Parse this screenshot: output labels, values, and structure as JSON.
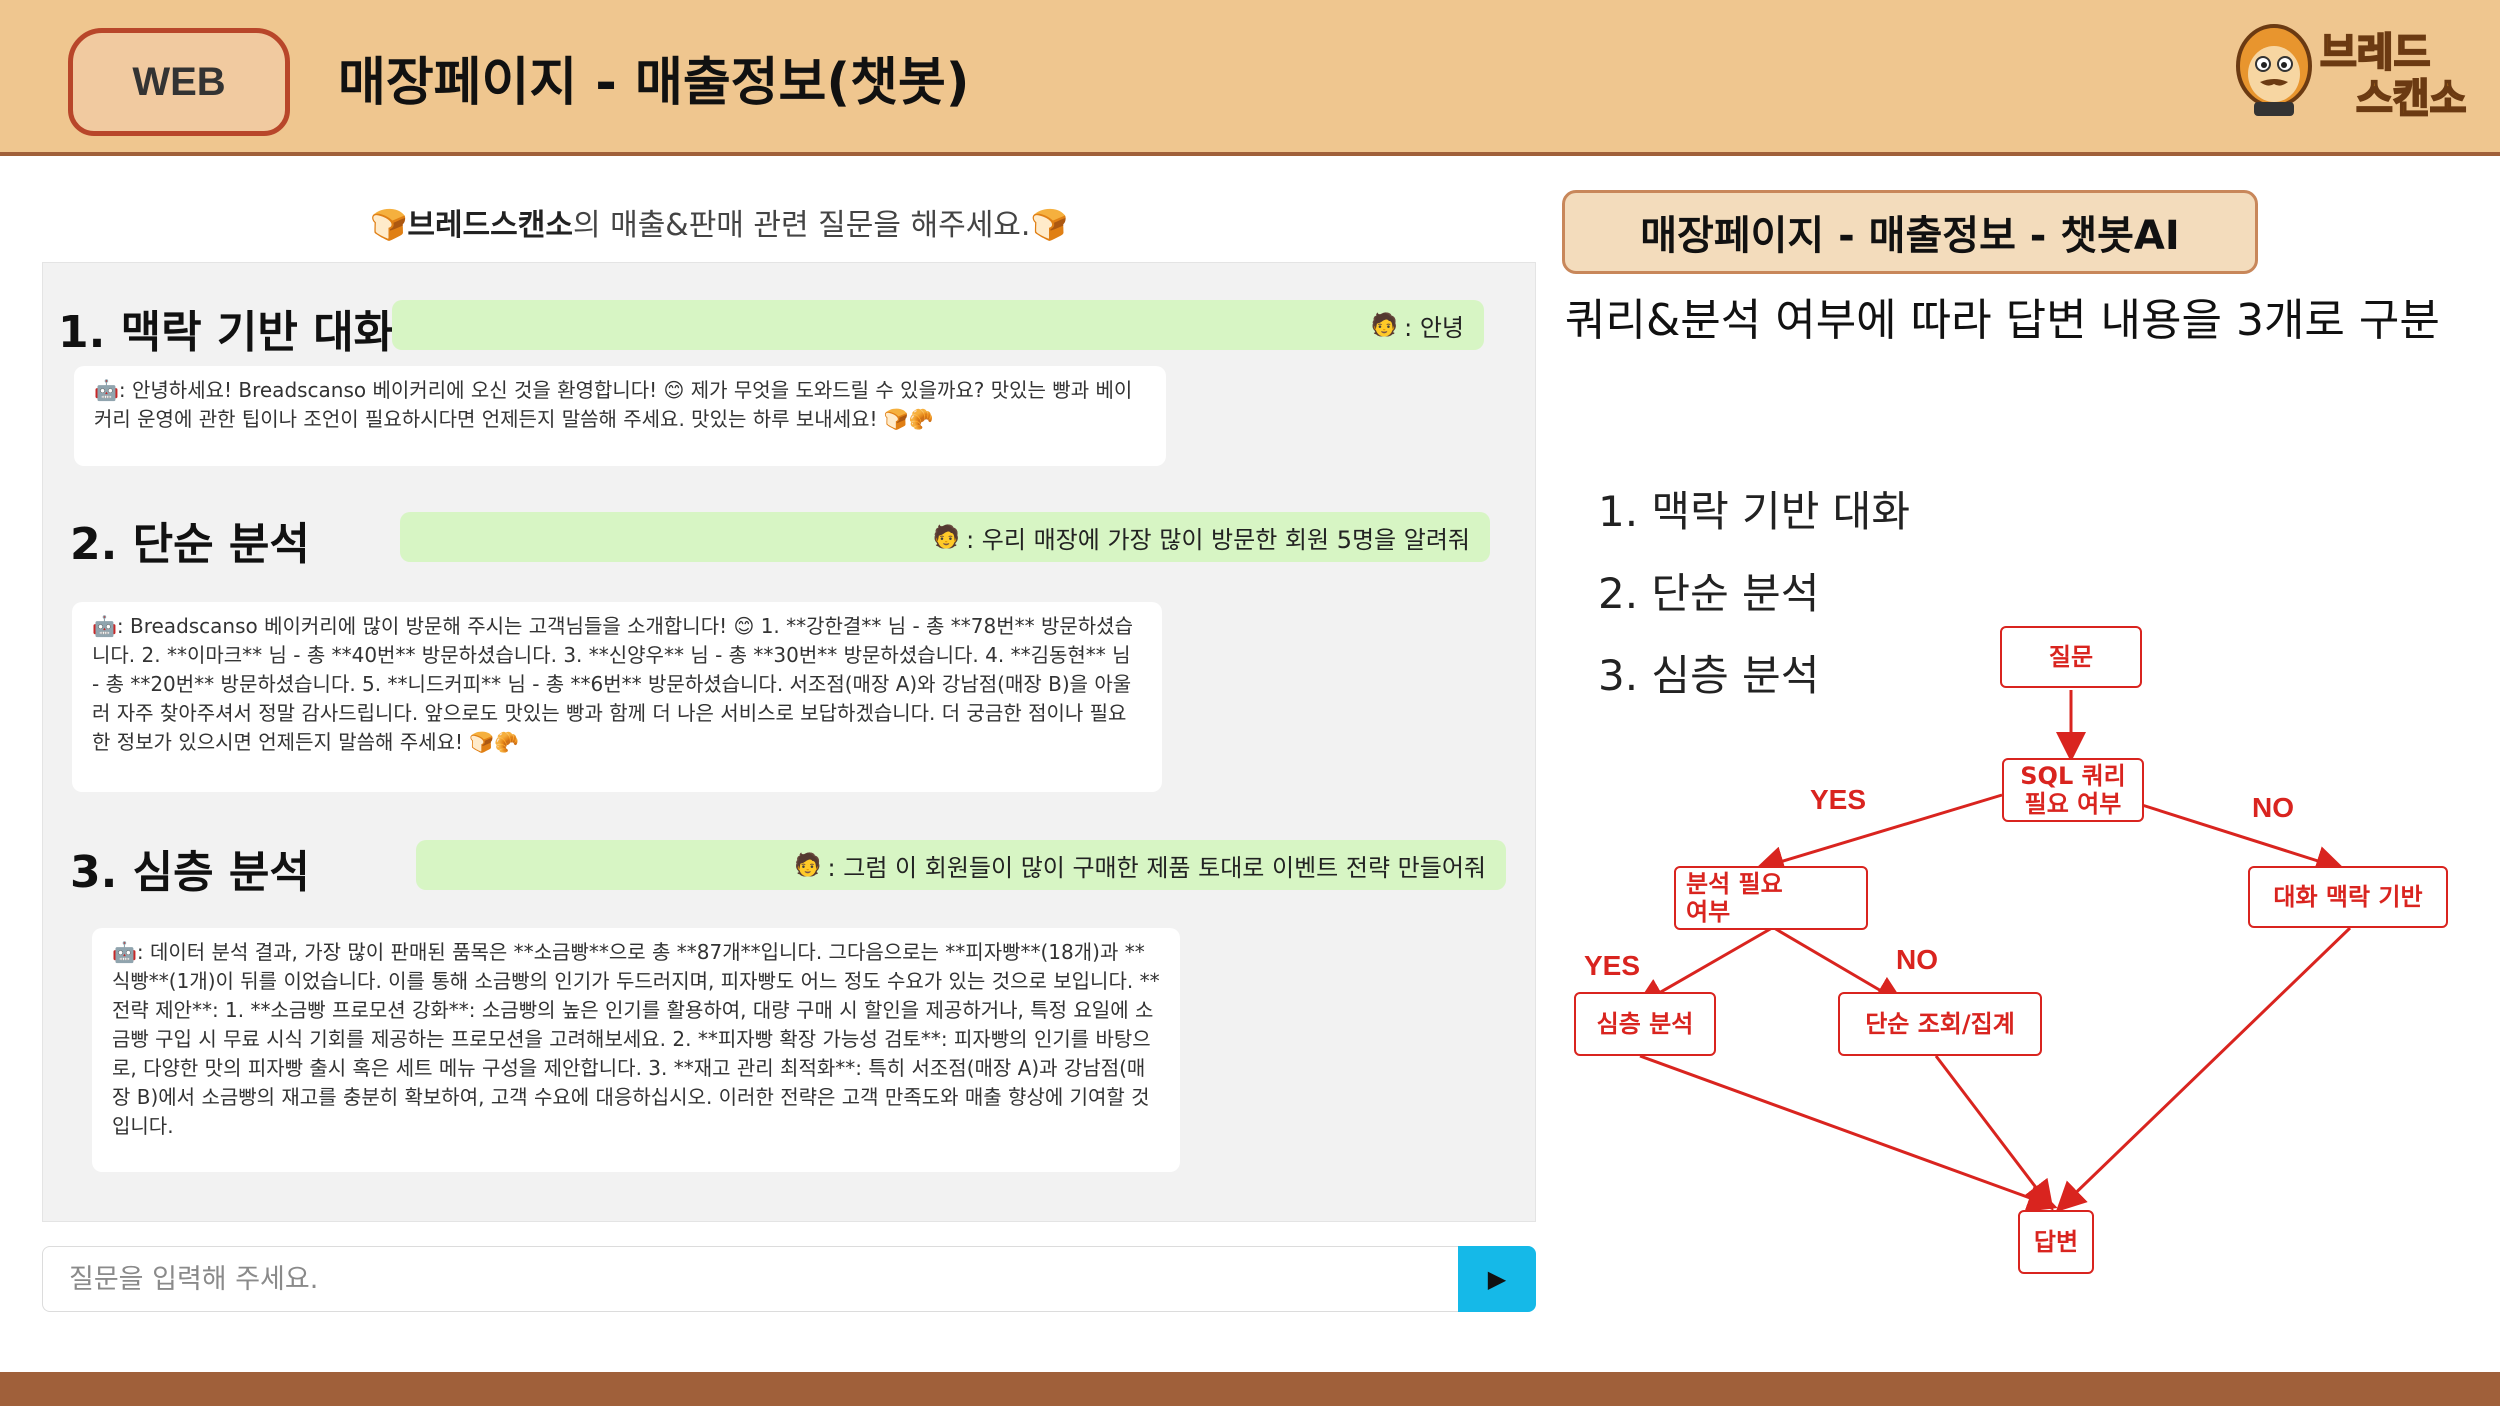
{
  "header": {
    "badge": "WEB",
    "title": "매장페이지 - 매출정보(챗봇)",
    "logo_line1": "브레드",
    "logo_line2": "스캔소"
  },
  "chat": {
    "heading_brand": "브레드스캔소",
    "heading_rest": "의 매출&판매 관련 질문을 해주세요.",
    "sections": [
      {
        "label": "1.  맥락 기반 대화",
        "user_message": ": 안녕",
        "bot_message": ": 안녕하세요! Breadscanso 베이커리에 오신 것을 환영합니다! 😊 제가 무엇을 도와드릴 수 있을까요? 맛있는 빵과 베이커리 운영에 관한 팁이나 조언이 필요하시다면 언제든지 말씀해 주세요. 맛있는 하루 보내세요! 🍞🥐"
      },
      {
        "label": "2. 단순 분석",
        "user_message": ": 우리 매장에 가장 많이 방문한 회원 5명을 알려줘",
        "bot_message": ": Breadscanso 베이커리에 많이 방문해 주시는 고객님들을 소개합니다! 😊 1. **강한결** 님 - 총 **78번** 방문하셨습니다. 2. **이마크** 님 - 총 **40번** 방문하셨습니다. 3. **신양우** 님 - 총 **30번** 방문하셨습니다. 4. **김동현** 님 - 총 **20번** 방문하셨습니다. 5. **니드커피** 님 - 총 **6번** 방문하셨습니다. 서조점(매장 A)와 강남점(매장 B)을 아울러 자주 찾아주셔서 정말 감사드립니다. 앞으로도 맛있는 빵과 함께 더 나은 서비스로 보답하겠습니다. 더 궁금한 점이나 필요한 정보가 있으시면 언제든지 말씀해 주세요! 🍞🥐"
      },
      {
        "label": "3. 심층 분석",
        "user_message": ": 그럼 이 회원들이 많이 구매한 제품 토대로 이벤트 전략 만들어줘",
        "bot_message": ": 데이터 분석 결과, 가장 많이 판매된 품목은 **소금빵**으로 총 **87개**입니다. 그다음으로는 **피자빵**(18개)과 **식빵**(1개)이 뒤를 이었습니다. 이를 통해 소금빵의 인기가 두드러지며, 피자빵도 어느 정도 수요가 있는 것으로 보입니다. **전략 제안**: 1. **소금빵 프로모션 강화**: 소금빵의 높은 인기를 활용하여, 대량 구매 시 할인을 제공하거나, 특정 요일에 소금빵 구입 시 무료 시식 기회를 제공하는 프로모션을 고려해보세요. 2. **피자빵 확장 가능성 검토**: 피자빵의 인기를 바탕으로, 다양한 맛의 피자빵 출시 혹은 세트 메뉴 구성을 제안합니다. 3. **재고 관리 최적화**: 특히 서조점(매장 A)과 강남점(매장 B)에서 소금빵의 재고를 충분히 확보하여, 고객 수요에 대응하십시오. 이러한 전략은 고객 만족도와 매출 향상에 기여할 것입니다."
      }
    ],
    "input_placeholder": "질문을 입력해 주세요.",
    "send_icon": "play-icon"
  },
  "right": {
    "title": "매장페이지 - 매출정보 - 챗봇AI",
    "description": "쿼리&분석 여부에 따라 답변 내용을 3개로 구분",
    "list": [
      "1.  맥락 기반 대화",
      "2.  단순 분석",
      "3.  심층 분석"
    ]
  },
  "flowchart": {
    "nodes": {
      "question": "질문",
      "sql_check": "SQL 쿼리\n필요 여부",
      "analysis_check": "분석 필요\n여부",
      "context_chat": "대화 맥락 기반",
      "deep_analysis": "심층 분석",
      "simple_query": "단순 조회/집계",
      "answer": "답변"
    },
    "labels": {
      "yes_sql": "YES",
      "no_sql": "NO",
      "yes_analysis": "YES",
      "no_analysis": "NO"
    },
    "color": "#d9241f"
  }
}
